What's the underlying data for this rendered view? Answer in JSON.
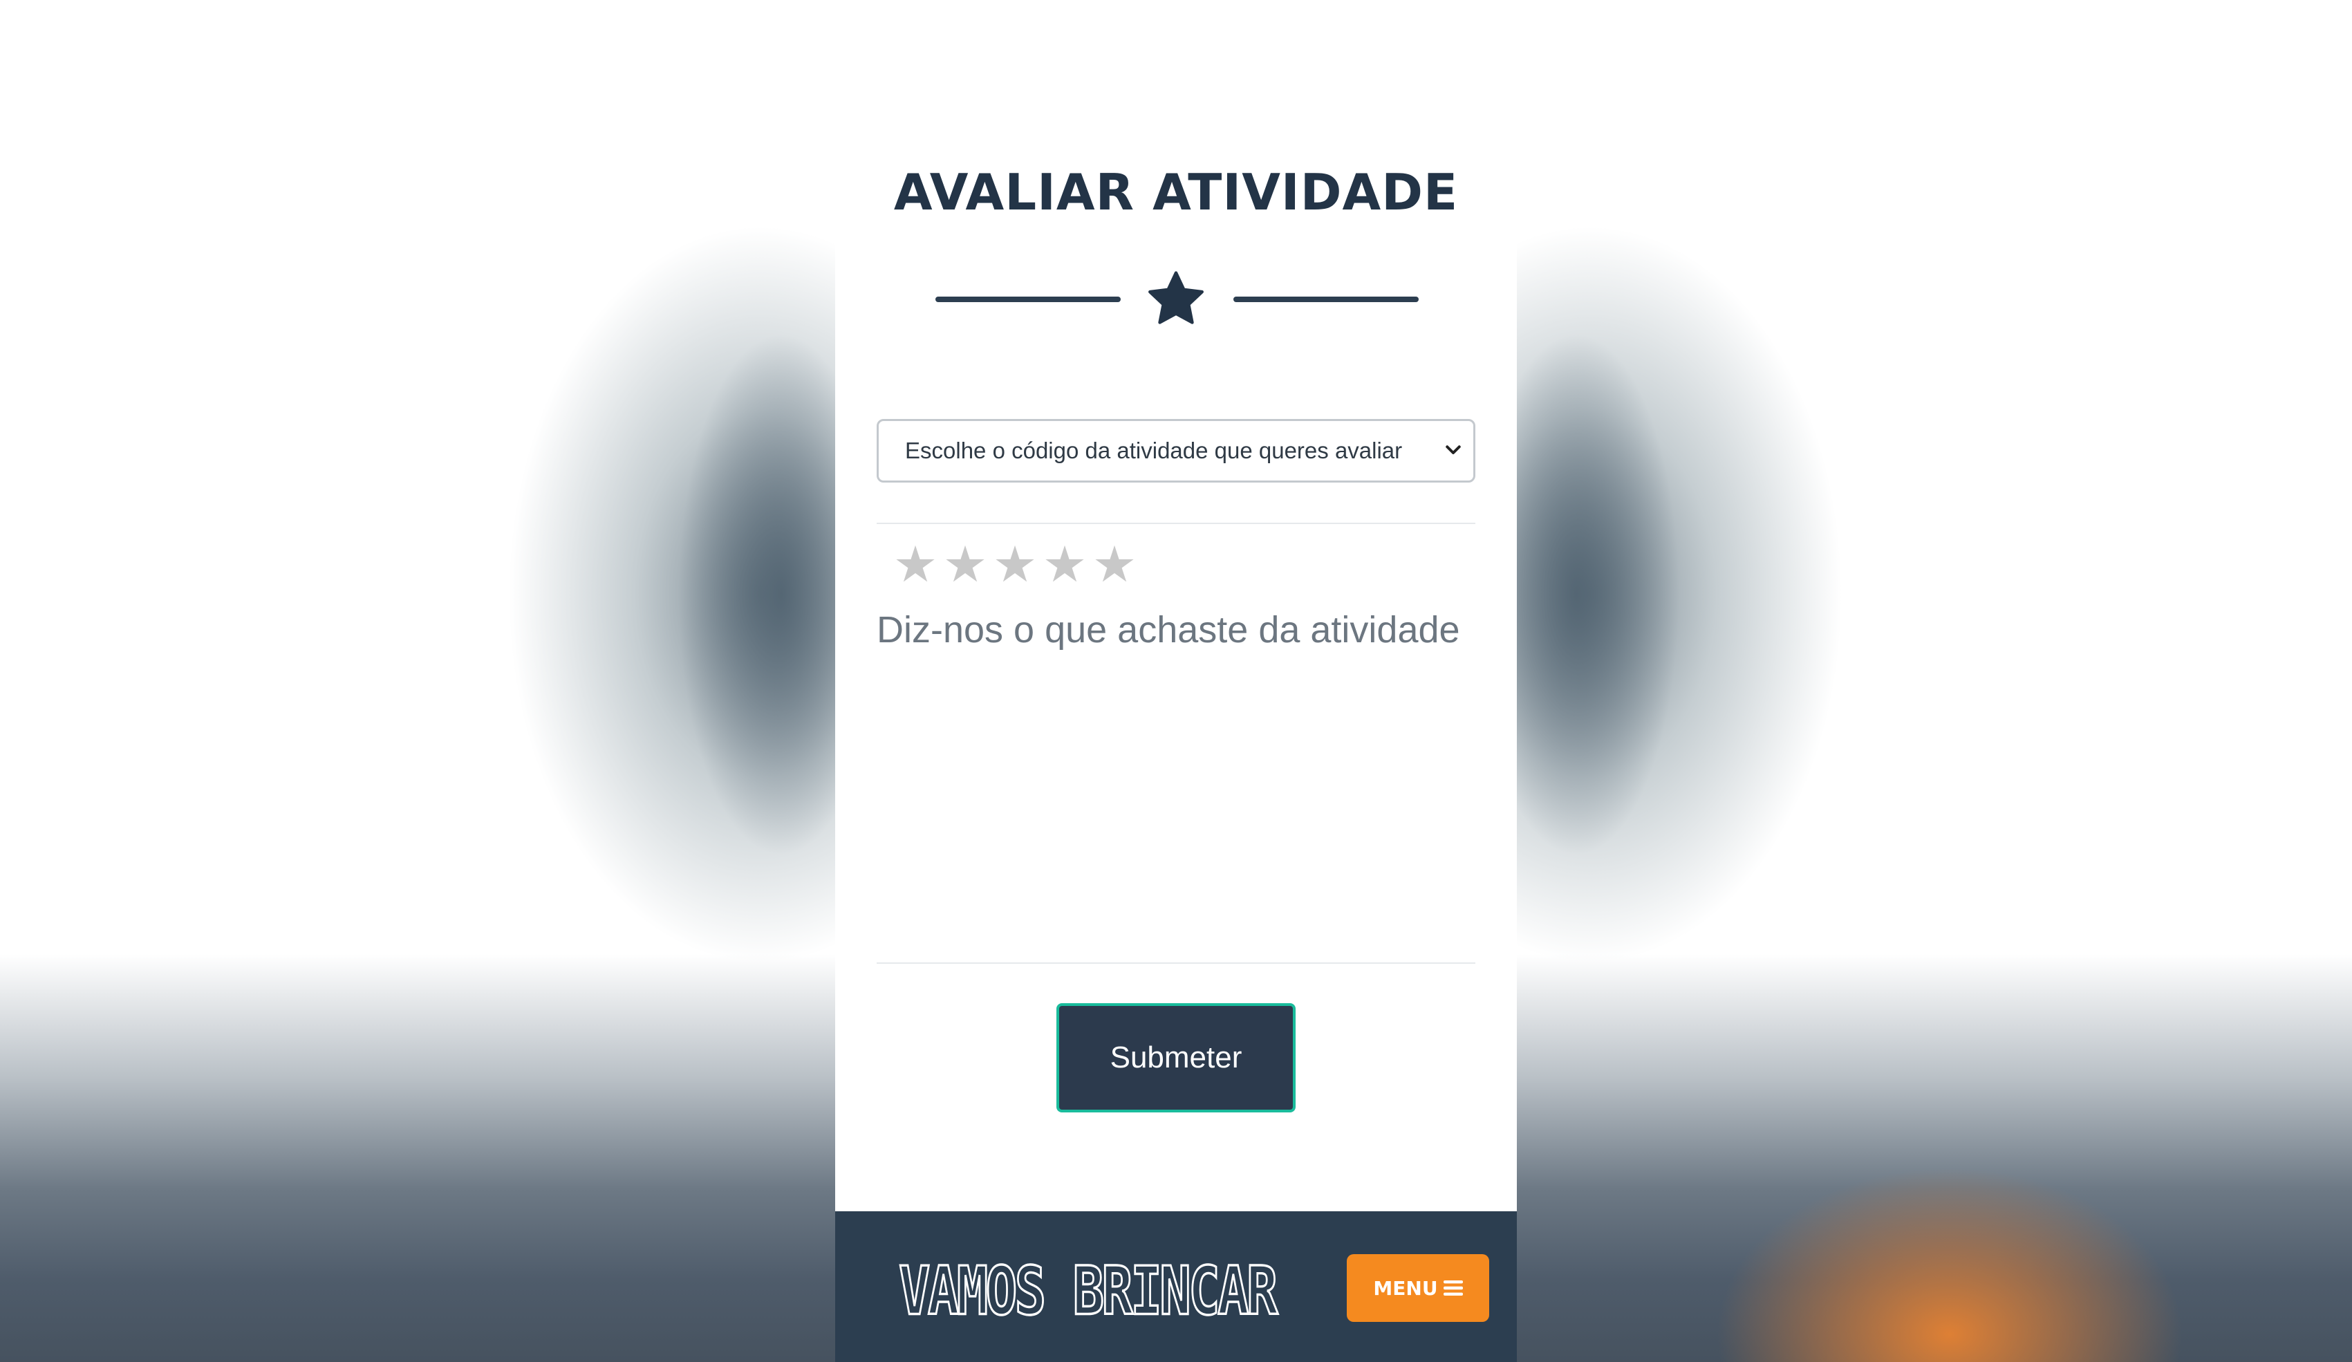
{
  "page": {
    "title": "AVALIAR ATIVIDADE"
  },
  "form": {
    "activity_select": {
      "selected_text": "Escolhe o código da atividade que queres avaliar"
    },
    "rating": {
      "max": 5,
      "value": 0,
      "star_glyph": "★"
    },
    "comment": {
      "placeholder": "Diz-nos o que achaste da atividade",
      "value": ""
    },
    "submit_label": "Submeter"
  },
  "navbar": {
    "logo_text": "VAMOS BRINCAR",
    "menu_label": "MENU",
    "menu_icon": "hamburger-icon"
  },
  "colors": {
    "primary_dark": "#2c3e50",
    "accent_teal": "#1abc9c",
    "menu_orange": "#f58a1f",
    "star_inactive": "#c8c8c8"
  }
}
